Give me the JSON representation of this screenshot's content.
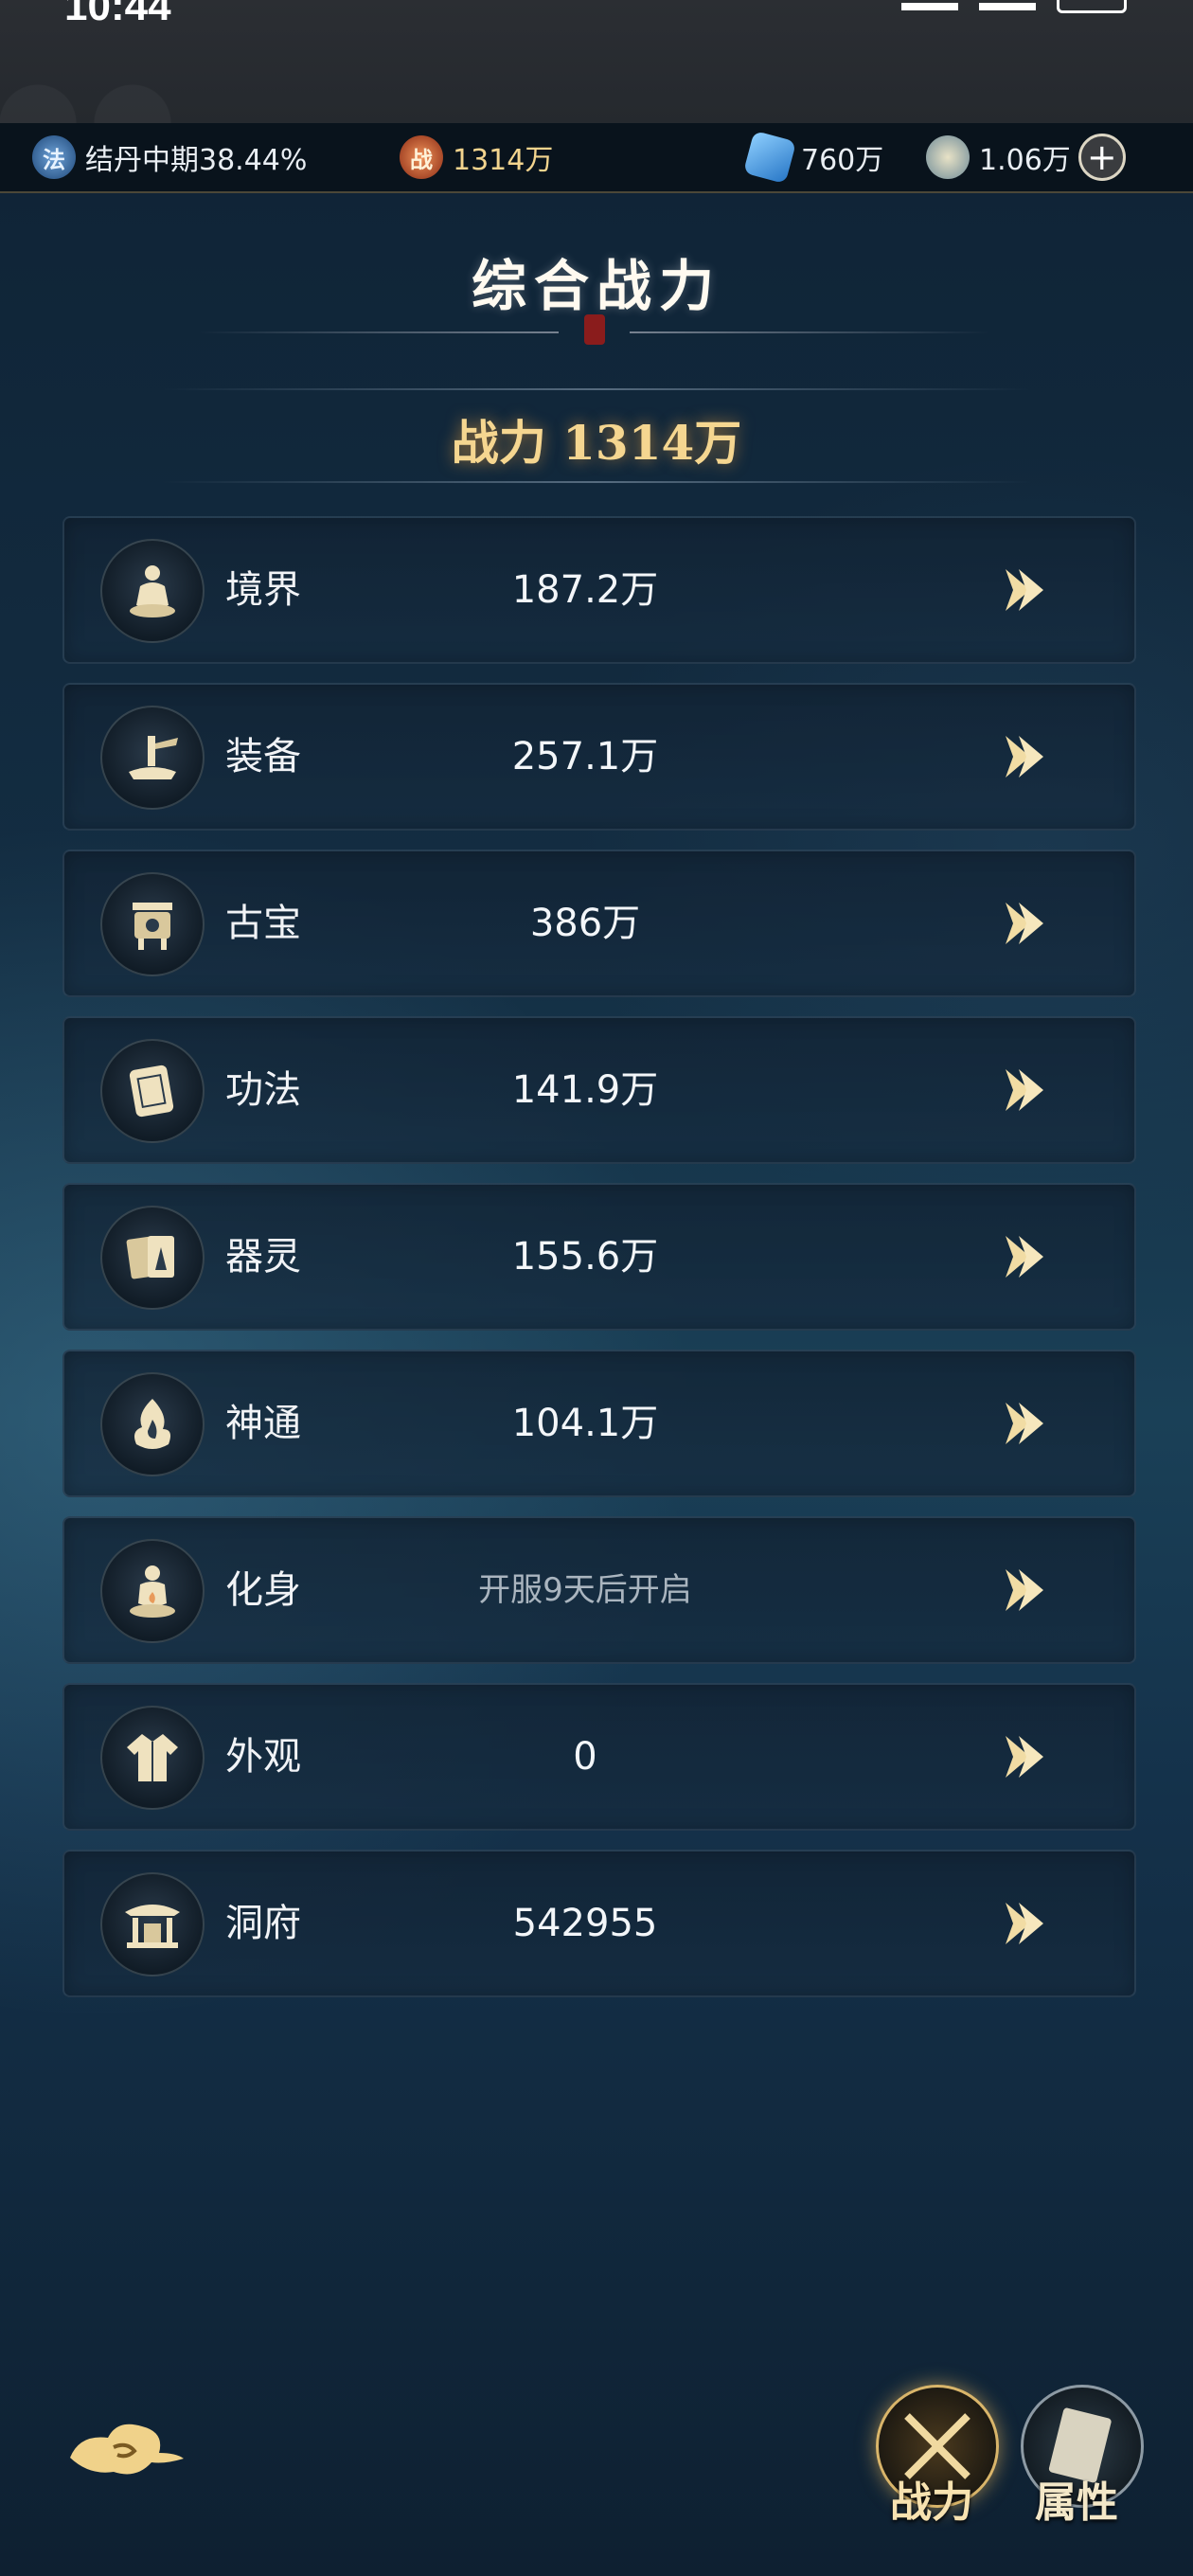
{
  "status_bar": {
    "time": "10:44"
  },
  "resources": {
    "realm": {
      "icon_char": "法",
      "text": "结丹中期38.44%"
    },
    "power": {
      "icon_char": "战",
      "value": "1314万"
    },
    "spirit_stone": {
      "value": "760万"
    },
    "coin": {
      "value": "1.06万"
    }
  },
  "title": "综合战力",
  "total_power": {
    "label": "战力",
    "value": "1314万"
  },
  "rows": [
    {
      "label": "境界",
      "value": "187.2万",
      "icon": "meditating-figure-icon"
    },
    {
      "label": "装备",
      "value": "257.1万",
      "icon": "weapon-equipment-icon"
    },
    {
      "label": "古宝",
      "value": "386万",
      "icon": "bronze-cauldron-icon"
    },
    {
      "label": "功法",
      "value": "141.9万",
      "icon": "scroll-book-icon"
    },
    {
      "label": "器灵",
      "value": "155.6万",
      "icon": "spirit-cards-icon"
    },
    {
      "label": "神通",
      "value": "104.1万",
      "icon": "flame-spirit-icon"
    },
    {
      "label": "化身",
      "value": "开服9天后开启",
      "icon": "avatar-figure-icon"
    },
    {
      "label": "外观",
      "value": "0",
      "icon": "robe-icon"
    },
    {
      "label": "洞府",
      "value": "542955",
      "icon": "cave-pavilion-icon"
    }
  ],
  "bottom_tabs": {
    "power": "战力",
    "attributes": "属性"
  },
  "colors": {
    "gold": "#f5d690",
    "accent": "#d9b56a"
  }
}
